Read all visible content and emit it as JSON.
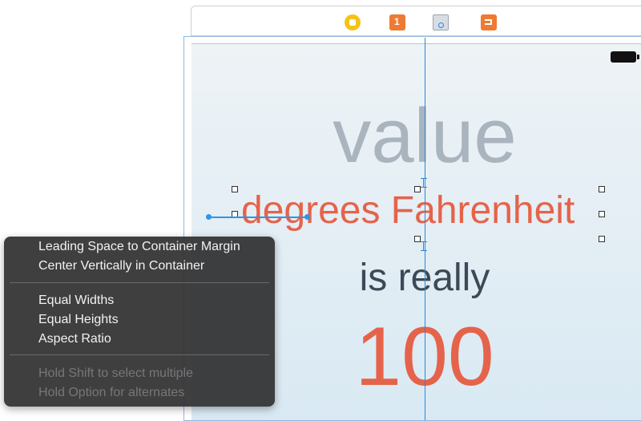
{
  "scene": {
    "dock_icons": [
      "view-controller-icon",
      "first-responder-icon",
      "view-icon",
      "exit-icon"
    ]
  },
  "canvas": {
    "labels": {
      "value": "value",
      "degrees": "degrees Fahrenheit",
      "is_really": "is really",
      "number": "100"
    },
    "colors": {
      "accent": "#e5634a",
      "placeholder": "#a9b4be",
      "body_text": "#3c4a57",
      "guide": "#2f86d6"
    }
  },
  "popup": {
    "items": [
      "Leading Space to Container Margin",
      "Center Vertically in Container",
      "Equal Widths",
      "Equal Heights",
      "Aspect Ratio"
    ],
    "hints": [
      "Hold Shift to select multiple",
      "Hold Option for alternates"
    ]
  }
}
